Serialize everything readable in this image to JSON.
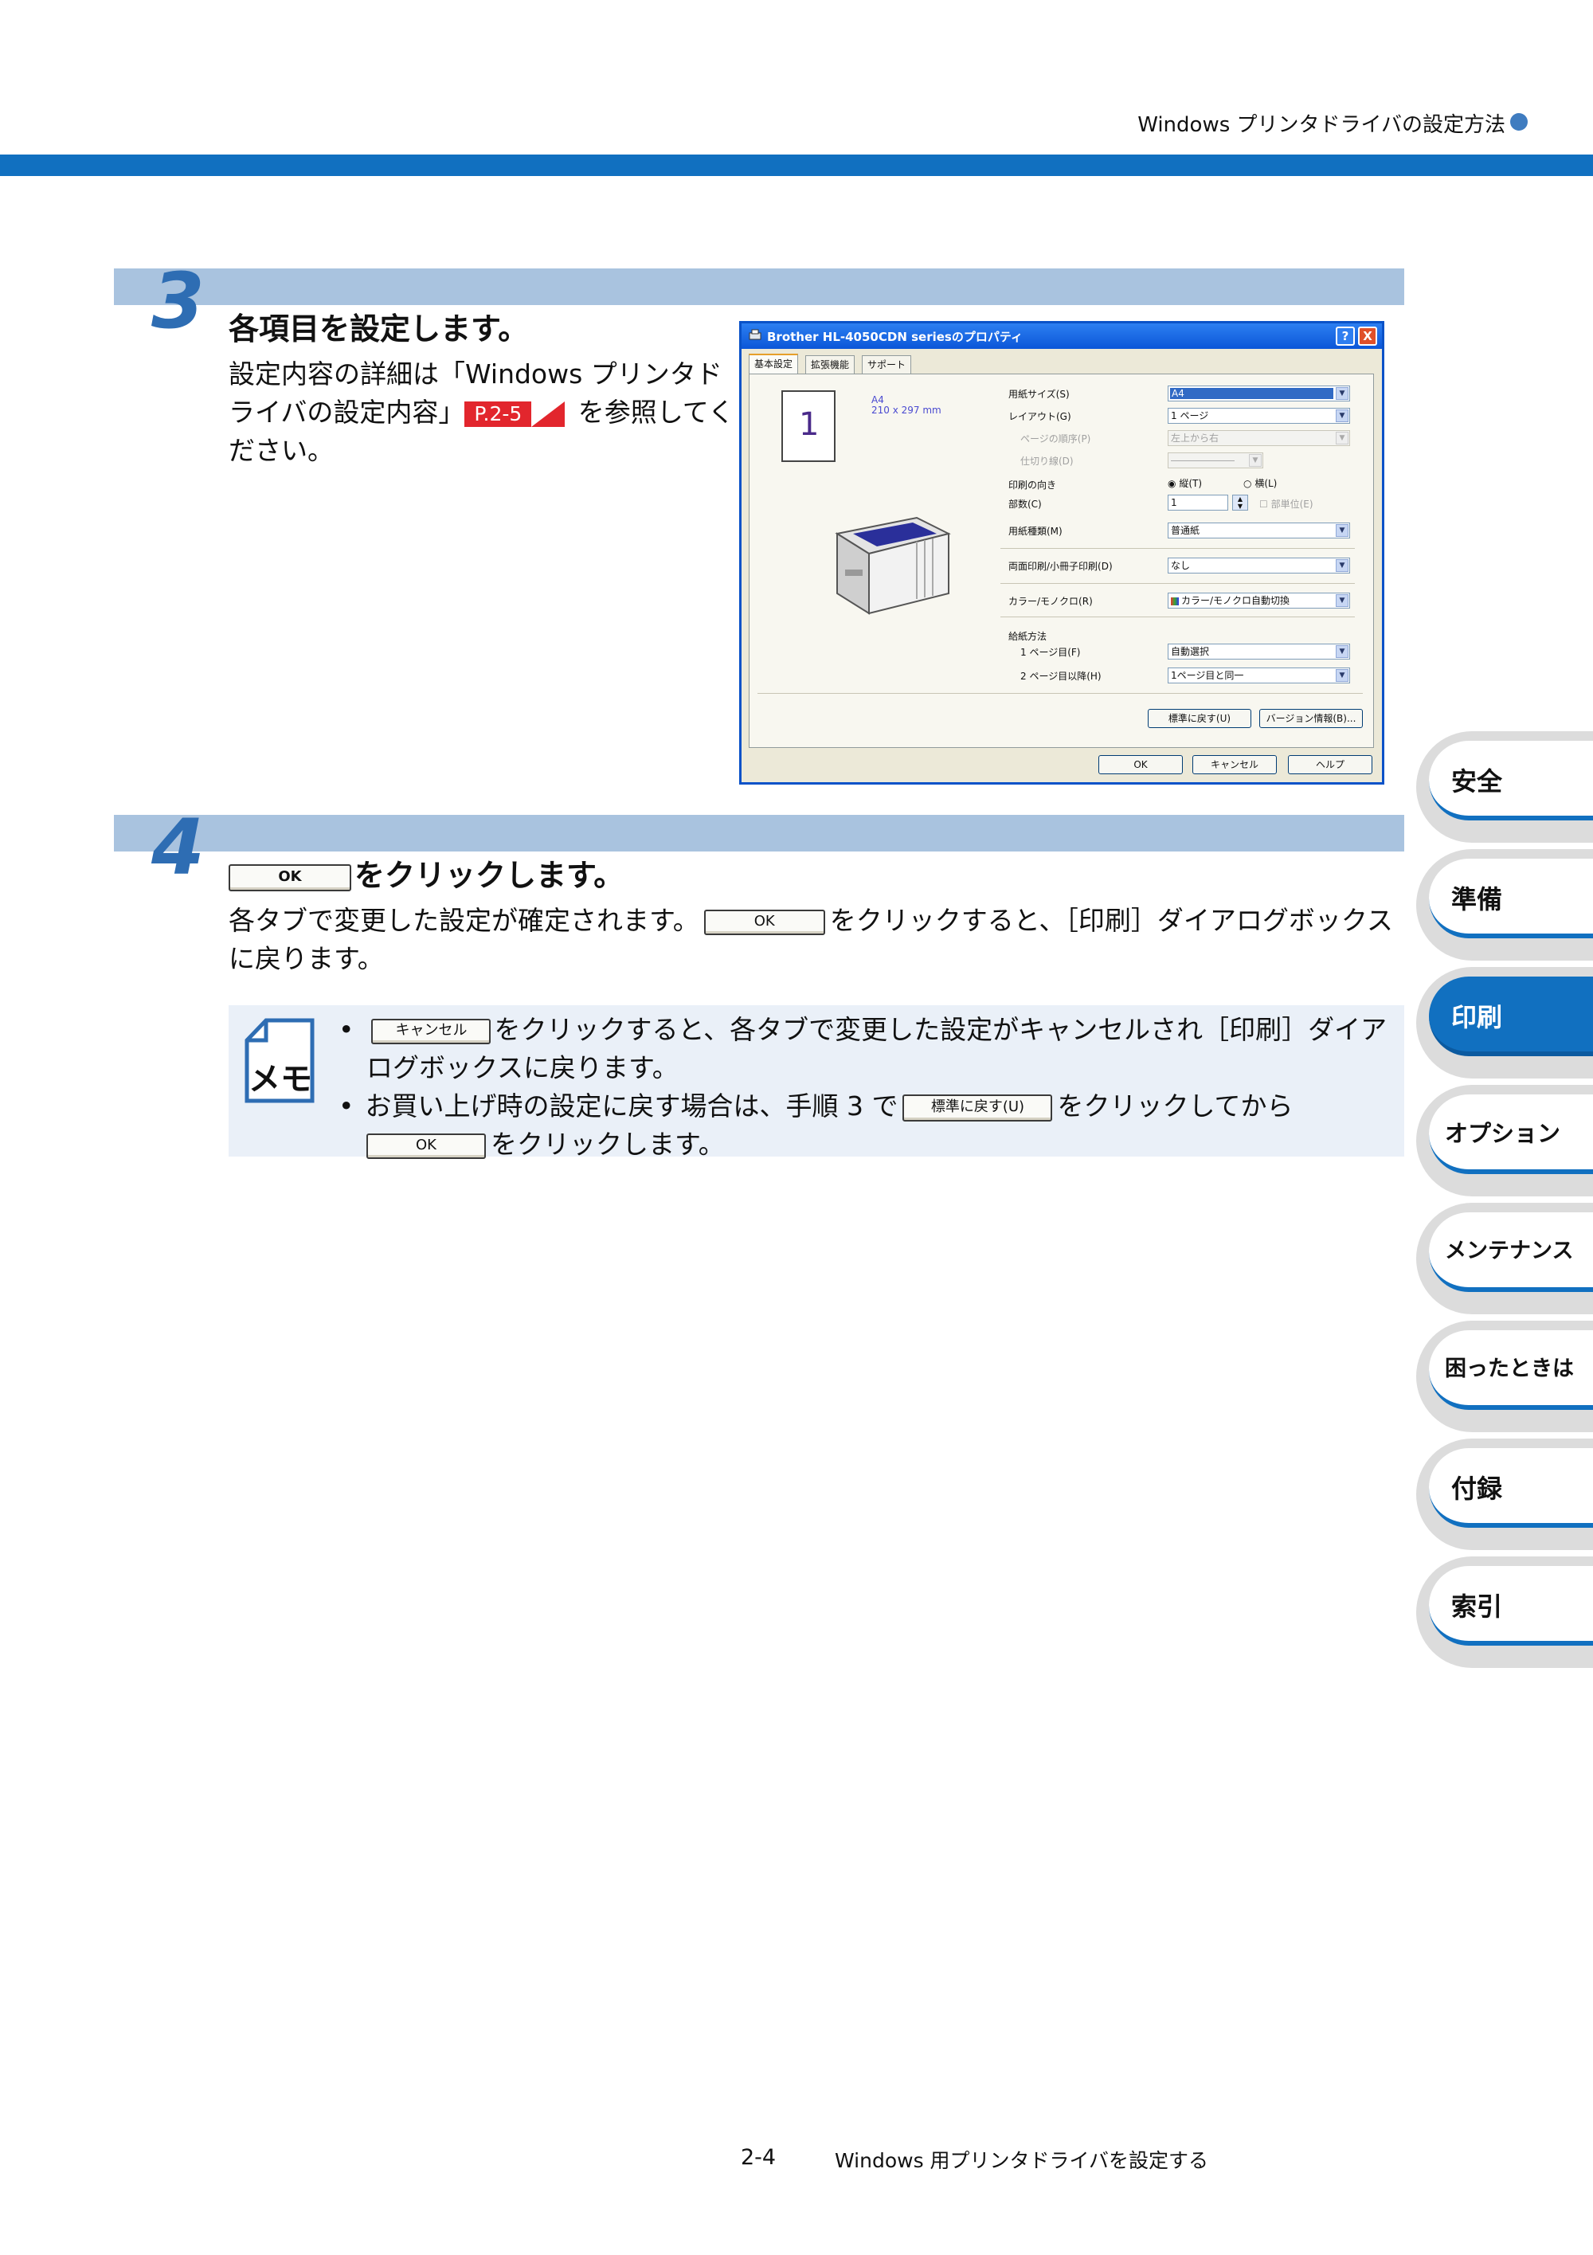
{
  "header": {
    "title": "Windows プリンタドライバの設定方法"
  },
  "step3": {
    "number": "3",
    "heading": "各項目を設定します。",
    "body_line1": "設定内容の詳細は「Windows プリンタド",
    "body_line2": "ライバの設定内容」",
    "ref": "P.2-5",
    "body_line2b": " を参照してく",
    "body_line3": "ださい。"
  },
  "dialog": {
    "title": "Brother HL-4050CDN seriesのプロパティ",
    "help_btn": "?",
    "close_btn": "X",
    "tabs": [
      "基本設定",
      "拡張機能",
      "サポート"
    ],
    "preview": {
      "page_number": "1",
      "paper": "A4",
      "paper_size": "210 x 297 mm"
    },
    "fields": [
      {
        "label": "用紙サイズ(S)",
        "value": "A4"
      },
      {
        "label": "レイアウト(G)",
        "value": "1 ページ"
      },
      {
        "label": "ページの順序(P)",
        "value": "左上から右"
      },
      {
        "label": "仕切り線(D)",
        "value": ""
      },
      {
        "label": "印刷の向き",
        "option1": "縦(T)",
        "option2": "横(L)"
      },
      {
        "label": "部数(C)",
        "value": "1",
        "checkbox": "部単位(E)"
      },
      {
        "label": "用紙種類(M)",
        "value": "普通紙"
      },
      {
        "label": "両面印刷/小冊子印刷(D)",
        "value": "なし"
      },
      {
        "label": "カラー/モノクロ(R)",
        "value": "カラー/モノクロ自動切換"
      },
      {
        "label": "給紙方法"
      },
      {
        "label": "1 ページ目(F)",
        "value": "自動選択"
      },
      {
        "label": "2 ページ目以降(H)",
        "value": "1ページ目と同一"
      }
    ],
    "default_btn": "標準に戻す(U)",
    "version_btn": "バージョン情報(B)...",
    "ok_btn": "OK",
    "cancel_btn": "キャンセル",
    "help_bottom_btn": "ヘルプ"
  },
  "step4": {
    "number": "4",
    "ok_label": "OK",
    "heading": "をクリックします。",
    "body1": "各タブで変更した設定が確定されます。",
    "body2": "をクリックすると、［印刷］ダイアログボックス",
    "body3": "に戻ります。"
  },
  "memo": {
    "icon_text": "メモ",
    "bullet": "•",
    "cancel_label": "キャンセル",
    "line1": "をクリックすると、各タブで変更した設定がキャンセルされ［印刷］ダイア",
    "line1b": "ログボックスに戻ります。",
    "line2": "お買い上げ時の設定に戻す場合は、手順 3 で",
    "default_label": "標準に戻す(U)",
    "line2b": "をクリックしてから",
    "ok_label": "OK",
    "line2c": "をクリックします。"
  },
  "side_tabs": [
    {
      "label": "安全",
      "active": false
    },
    {
      "label": "準備",
      "active": false
    },
    {
      "label": "印刷",
      "active": true
    },
    {
      "label": "オプション",
      "active": false
    },
    {
      "label": "メンテナンス",
      "active": false
    },
    {
      "label": "困ったときは",
      "active": false
    },
    {
      "label": "付録",
      "active": false
    },
    {
      "label": "索引",
      "active": false
    }
  ],
  "footer": {
    "page": "2-4",
    "title": "Windows 用プリンタドライバを設定する"
  },
  "colors": {
    "accent": "#1170c0",
    "band": "#a9c3df",
    "step_number": "#2e6db3",
    "ref_tag": "#e2262d",
    "memo_bg": "#eaf0f8"
  }
}
